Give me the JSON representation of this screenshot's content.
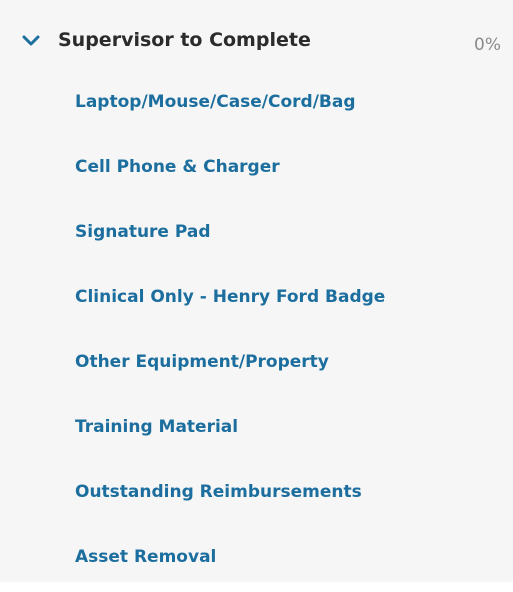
{
  "section": {
    "title": "Supervisor to Complete",
    "progress": "0%",
    "expanded": true,
    "toggle_icon": "chevron-down-icon",
    "colors": {
      "title": "#2b2b2b",
      "link": "#1c6e9e",
      "chevron": "#1c6e9e",
      "progress": "#8a8a8a",
      "background": "#f6f6f6"
    },
    "items": [
      {
        "label": "Laptop/Mouse/Case/Cord/Bag"
      },
      {
        "label": "Cell Phone & Charger"
      },
      {
        "label": "Signature Pad"
      },
      {
        "label": "Clinical Only - Henry Ford Badge"
      },
      {
        "label": "Other Equipment/Property"
      },
      {
        "label": "Training Material"
      },
      {
        "label": "Outstanding Reimbursements"
      },
      {
        "label": "Asset Removal"
      }
    ]
  }
}
